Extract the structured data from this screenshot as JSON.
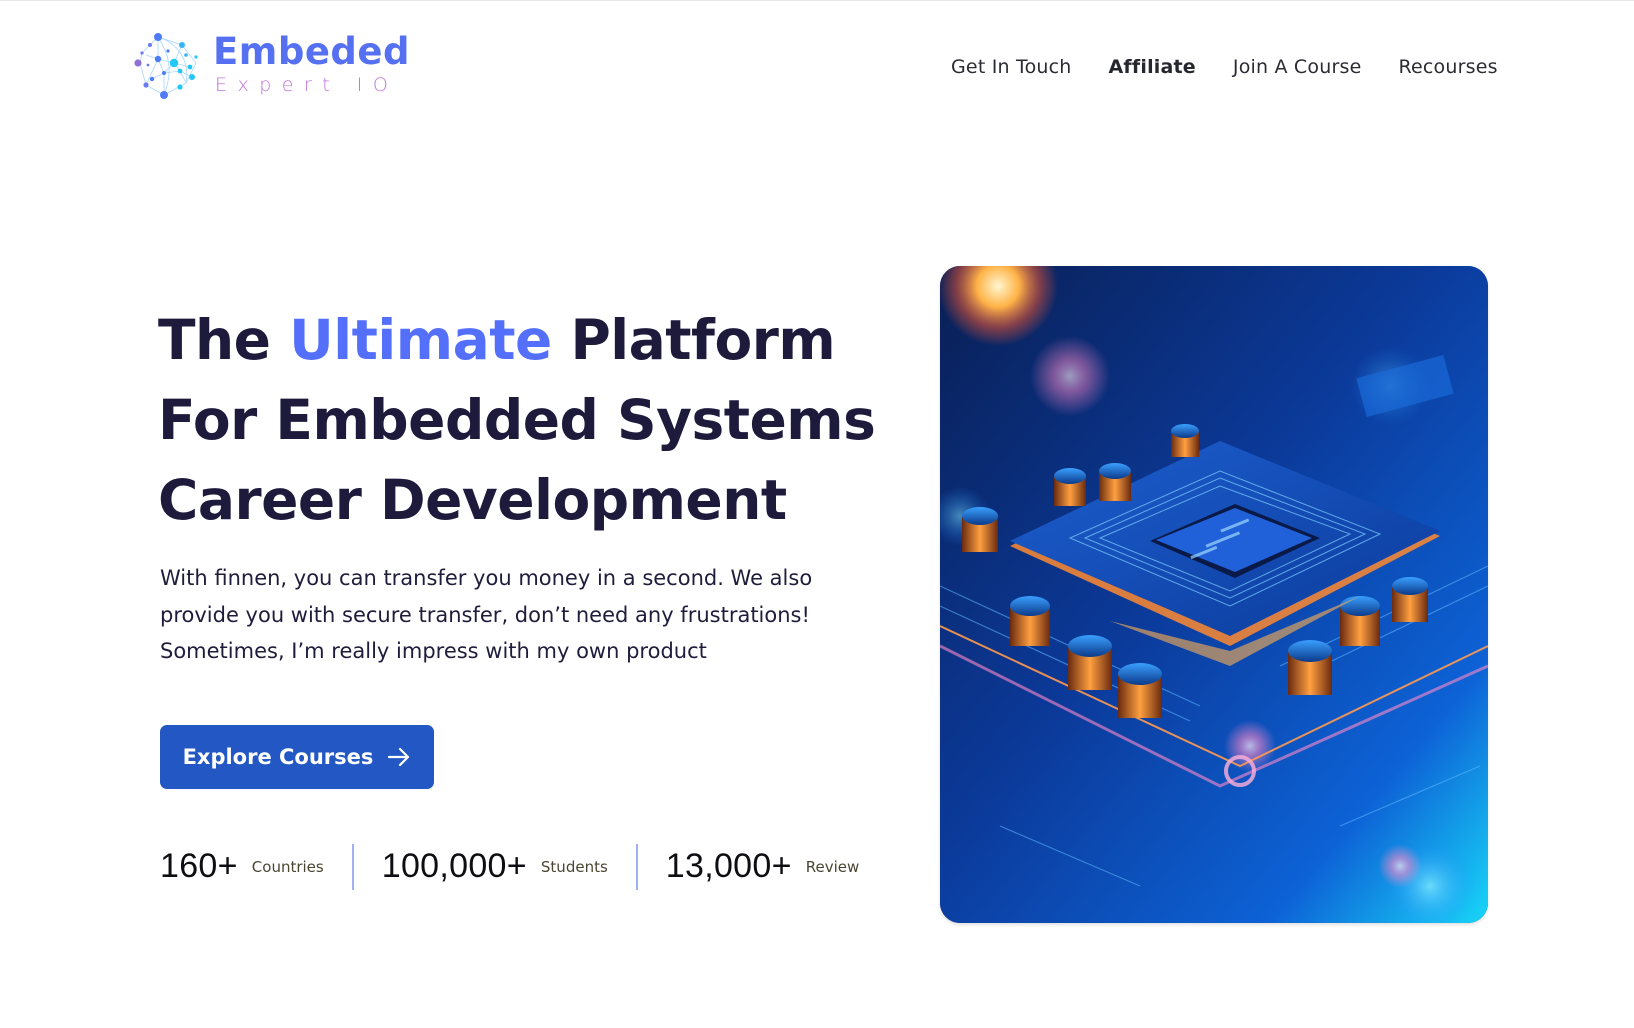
{
  "brand": {
    "name": "Embeded",
    "tagline": "Expert IO",
    "icon": "network-globe-icon",
    "colors": {
      "primary": "#5570f0",
      "secondary": "#c272dc"
    }
  },
  "nav": {
    "items": [
      {
        "label": "Get In Touch",
        "active": false
      },
      {
        "label": "Affiliate",
        "active": true
      },
      {
        "label": "Join A Course",
        "active": false
      },
      {
        "label": "Recourses",
        "active": false
      }
    ]
  },
  "hero": {
    "title": {
      "line1_pre": "The ",
      "line1_accent": "Ultimate",
      "line1_post": " Platform",
      "line2": "For Embedded Systems",
      "line3": "Career Development"
    },
    "description": "With finnen, you can transfer you money in a second. We also provide you with secure transfer, don’t need any frustrations! Sometimes, I’m really impress with my own product",
    "cta": {
      "label": "Explore Courses",
      "icon": "arrow-right-icon"
    },
    "stats": [
      {
        "value": "160+",
        "label": "Countries"
      },
      {
        "value": "100,000+",
        "label": "Students"
      },
      {
        "value": "13,000+",
        "label": "Review"
      }
    ],
    "image": {
      "subject": "circuit-board-chip-photo"
    },
    "colors": {
      "accent": "#5470fa",
      "button": "#2257c4",
      "divider": "#9fb0f2",
      "heading": "#1d1a3c"
    }
  }
}
